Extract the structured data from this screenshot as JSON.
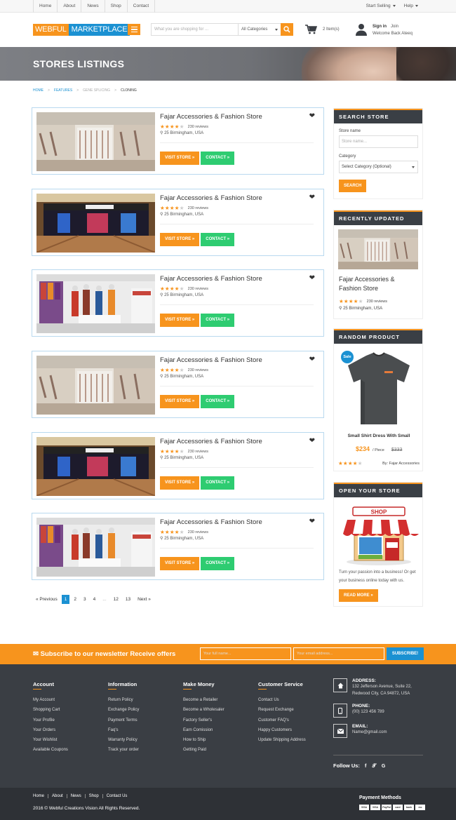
{
  "topbar": {
    "links": [
      "Home",
      "About",
      "News",
      "Shop",
      "Contact"
    ],
    "start_selling": "Start Selling",
    "help": "Help"
  },
  "header": {
    "logo_a": "WEBFUL",
    "logo_b": "MARKETPLACE",
    "search_placeholder": "What you are shopping for ...",
    "category": "All Categories",
    "cart_count": "2 Item(s)",
    "sign_in": "Sign in",
    "join": "Join",
    "welcome": "Welcome Back Ateeq"
  },
  "banner": {
    "title": "STORES LISTINGS"
  },
  "breadcrumb": {
    "home": "HOME",
    "features": "FEATURES",
    "gene": "GENE SPLICING",
    "current": "CLONING"
  },
  "stores": [
    {
      "name": "Fajar Accessories & Fashion Store",
      "reviews": "230 reviews",
      "location": "25 Birmingham, USA",
      "visit": "VISIT STORE »",
      "contact": "CONTACT »",
      "img": "mall"
    },
    {
      "name": "Fajar Accessories & Fashion Store",
      "reviews": "230 reviews",
      "location": "25 Birmingham, USA",
      "visit": "VISIT STORE »",
      "contact": "CONTACT »",
      "img": "shop"
    },
    {
      "name": "Fajar Accessories & Fashion Store",
      "reviews": "230 reviews",
      "location": "25 Birmingham, USA",
      "visit": "VISIT STORE »",
      "contact": "CONTACT »",
      "img": "clothes"
    },
    {
      "name": "Fajar Accessories & Fashion Store",
      "reviews": "230 reviews",
      "location": "25 Birmingham, USA",
      "visit": "VISIT STORE »",
      "contact": "CONTACT »",
      "img": "mall"
    },
    {
      "name": "Fajar Accessories & Fashion Store",
      "reviews": "230 reviews",
      "location": "25 Birmingham, USA",
      "visit": "VISIT STORE »",
      "contact": "CONTACT »",
      "img": "shop"
    },
    {
      "name": "Fajar Accessories & Fashion Store",
      "reviews": "230 reviews",
      "location": "25 Birmingham, USA",
      "visit": "VISIT STORE »",
      "contact": "CONTACT »",
      "img": "clothes"
    }
  ],
  "rating_stars": 3.5,
  "pagination": {
    "prev": "« Previous",
    "pages": [
      "1",
      "2",
      "3",
      "4",
      "...",
      "12",
      "13"
    ],
    "next": "Next »",
    "current": "1"
  },
  "search_store": {
    "title": "SEARCH STORE",
    "store_name_label": "Store name",
    "store_name_placeholder": "Store name...",
    "category_label": "Category",
    "category_value": "Select Category (Optional)",
    "button": "SEARCH"
  },
  "recently_updated": {
    "title": "RECENTLY UPDATED",
    "name": "Fajar Accessories & Fashion Store",
    "reviews": "230 reviews",
    "location": "25 Birmingham, USA"
  },
  "random_product": {
    "title": "RANDOM PRODUCT",
    "badge": "Sale",
    "name": "Small Shirt Dress With Small",
    "price": "$234",
    "per": "/ Piece",
    "old_price": "$333",
    "by": "By: Fajar Accessories"
  },
  "open_store": {
    "title": "OPEN YOUR STORE",
    "shop_sign": "SHOP",
    "text": "Turn your passion into a business! Or get your business online today with us.",
    "button": "READ MORE »"
  },
  "newsletter": {
    "text": "Subscribe to our newsletter Receive offers",
    "name_placeholder": "Your full name...",
    "email_placeholder": "Your email address...",
    "button": "SUBSCRIBE!"
  },
  "footer": {
    "account": {
      "title": "Account",
      "items": [
        "My Account",
        "Shopping Cart",
        "Your Profile",
        "Your Orders",
        "Your Wishlist",
        "Available Coupons"
      ]
    },
    "information": {
      "title": "Information",
      "items": [
        "Return Policy",
        "Exchange Policy",
        "Payment Terms",
        "Faq's",
        "Warranty Policy",
        "Track your order"
      ]
    },
    "make_money": {
      "title": "Make Money",
      "items": [
        "Become a Retailer",
        "Become a Wholesaler",
        "Factory Seller's",
        "Earn Comission",
        "How to Ship",
        "Getting Paid"
      ]
    },
    "customer_service": {
      "title": "Customer Service",
      "items": [
        "Contact Us",
        "Request Exchange",
        "Customer FAQ's",
        "Happy Customers",
        "Update Shipping Address"
      ]
    },
    "address_label": "ADDRESS:",
    "address": "132 Jefferson Avenue, Suite 22, Redwood City, CA 94872, USA",
    "phone_label": "PHONE:",
    "phone": "(00) 123 456 789",
    "email_label": "EMAIL:",
    "email": "Name@gmail.com",
    "follow": "Follow Us:"
  },
  "bottom": {
    "links": [
      "Home",
      "About",
      "News",
      "Shop",
      "Contact Us"
    ],
    "copyright": "2016 © Webful Creations Vision All Rights Reserved.",
    "payment_title": "Payment Methods",
    "payment_icons": [
      "VISA",
      "VISA",
      "PayPal",
      "card",
      "bank",
      "mc"
    ]
  },
  "colors": {
    "accent": "#f7941d",
    "blue": "#1b91d2",
    "green": "#2ecc71",
    "dark": "#3a3e44"
  }
}
